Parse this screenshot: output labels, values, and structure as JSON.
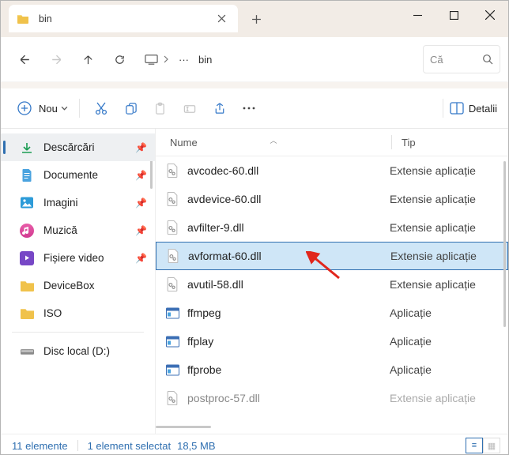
{
  "titlebar": {
    "tab_title": "bin"
  },
  "toolbar": {
    "new_label": "Nou",
    "details_label": "Detalii"
  },
  "address": {
    "crumb": "bin"
  },
  "search": {
    "placeholder": "Că"
  },
  "sidebar": {
    "items": [
      {
        "label": "Descărcări",
        "pin": true
      },
      {
        "label": "Documente",
        "pin": true
      },
      {
        "label": "Imagini",
        "pin": true
      },
      {
        "label": "Muzică",
        "pin": true
      },
      {
        "label": "Fișiere video",
        "pin": true
      },
      {
        "label": "DeviceBox",
        "pin": false
      },
      {
        "label": "ISO",
        "pin": false
      },
      {
        "label": "Disc local (D:)",
        "pin": false
      }
    ]
  },
  "columns": {
    "name": "Nume",
    "type": "Tip"
  },
  "files": [
    {
      "name": "avcodec-60.dll",
      "type": "Extensie aplicație",
      "kind": "dll"
    },
    {
      "name": "avdevice-60.dll",
      "type": "Extensie aplicație",
      "kind": "dll"
    },
    {
      "name": "avfilter-9.dll",
      "type": "Extensie aplicație",
      "kind": "dll"
    },
    {
      "name": "avformat-60.dll",
      "type": "Extensie aplicație",
      "kind": "dll",
      "selected": true
    },
    {
      "name": "avutil-58.dll",
      "type": "Extensie aplicație",
      "kind": "dll"
    },
    {
      "name": "ffmpeg",
      "type": "Aplicație",
      "kind": "exe"
    },
    {
      "name": "ffplay",
      "type": "Aplicație",
      "kind": "exe"
    },
    {
      "name": "ffprobe",
      "type": "Aplicație",
      "kind": "exe"
    },
    {
      "name": "postproc-57.dll",
      "type": "Extensie aplicație",
      "kind": "dll",
      "fade": true
    }
  ],
  "status": {
    "count": "11 elemente",
    "selected": "1 element selectat",
    "size": "18,5 MB"
  }
}
